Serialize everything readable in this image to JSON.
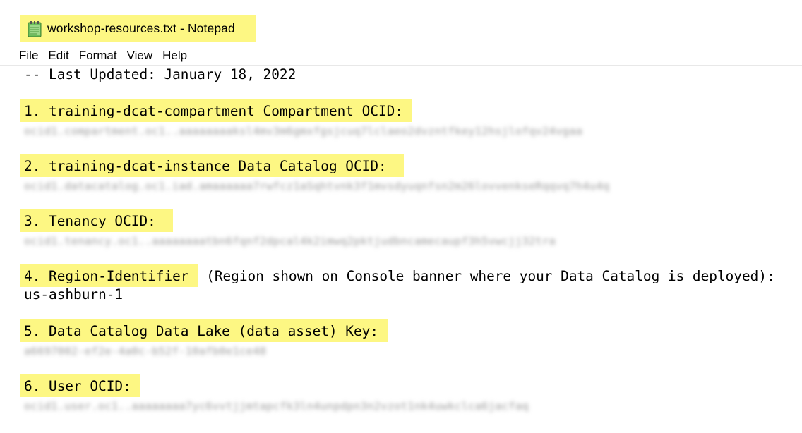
{
  "window": {
    "title": "workshop-resources.txt - Notepad",
    "minimize_label": "—"
  },
  "menu": [
    {
      "accel": "F",
      "rest": "ile"
    },
    {
      "accel": "E",
      "rest": "dit"
    },
    {
      "accel": "F",
      "rest": "ormat"
    },
    {
      "accel": "V",
      "rest": "iew"
    },
    {
      "accel": "H",
      "rest": "elp"
    }
  ],
  "document": {
    "last_updated": "-- Last Updated: January 18, 2022",
    "items": [
      {
        "heading": "1. training-dcat-compartment Compartment OCID:",
        "value_redacted": "ocid1.compartment.oc1..aaaaaaaaksl4mv3m6gmxfgsjcuq7lclaeo2dvzntfkey12hsjlofqv24vgaa"
      },
      {
        "heading": "2. training-dcat-instance Data Catalog OCID: ",
        "value_redacted": "ocid1.datacatalog.oc1.iad.amaaaaaa7rwfcz1aSqhtvnk3f1mvsdyuqnfsn2m26lovvenkseRqqvq7h4u4q"
      },
      {
        "heading": "3. Tenancy OCID: ",
        "value_redacted": "ocid1.tenancy.oc1..aaaaaaaatbn6fqnf2dpcal4k2imwq2pktjudbncamecaupf3h5vwcjj32tra"
      },
      {
        "heading": "4. Region-Identifier",
        "heading_suffix": " (Region shown on Console banner where your Data Catalog is deployed):",
        "value": "us-ashburn-1"
      },
      {
        "heading": "5. Data Catalog Data Lake (data asset) Key:",
        "value_redacted": "a6697002-ef2e-4a0c-b52f-10afb0e1ce48"
      },
      {
        "heading": "6. User OCID:",
        "value_redacted": "ocid1.user.oc1..aaaaaaaa7yc6vvtjjmtapcfk3ln4unpdpn3n2vzot1nk4uwkclca6jacfaq"
      }
    ]
  }
}
